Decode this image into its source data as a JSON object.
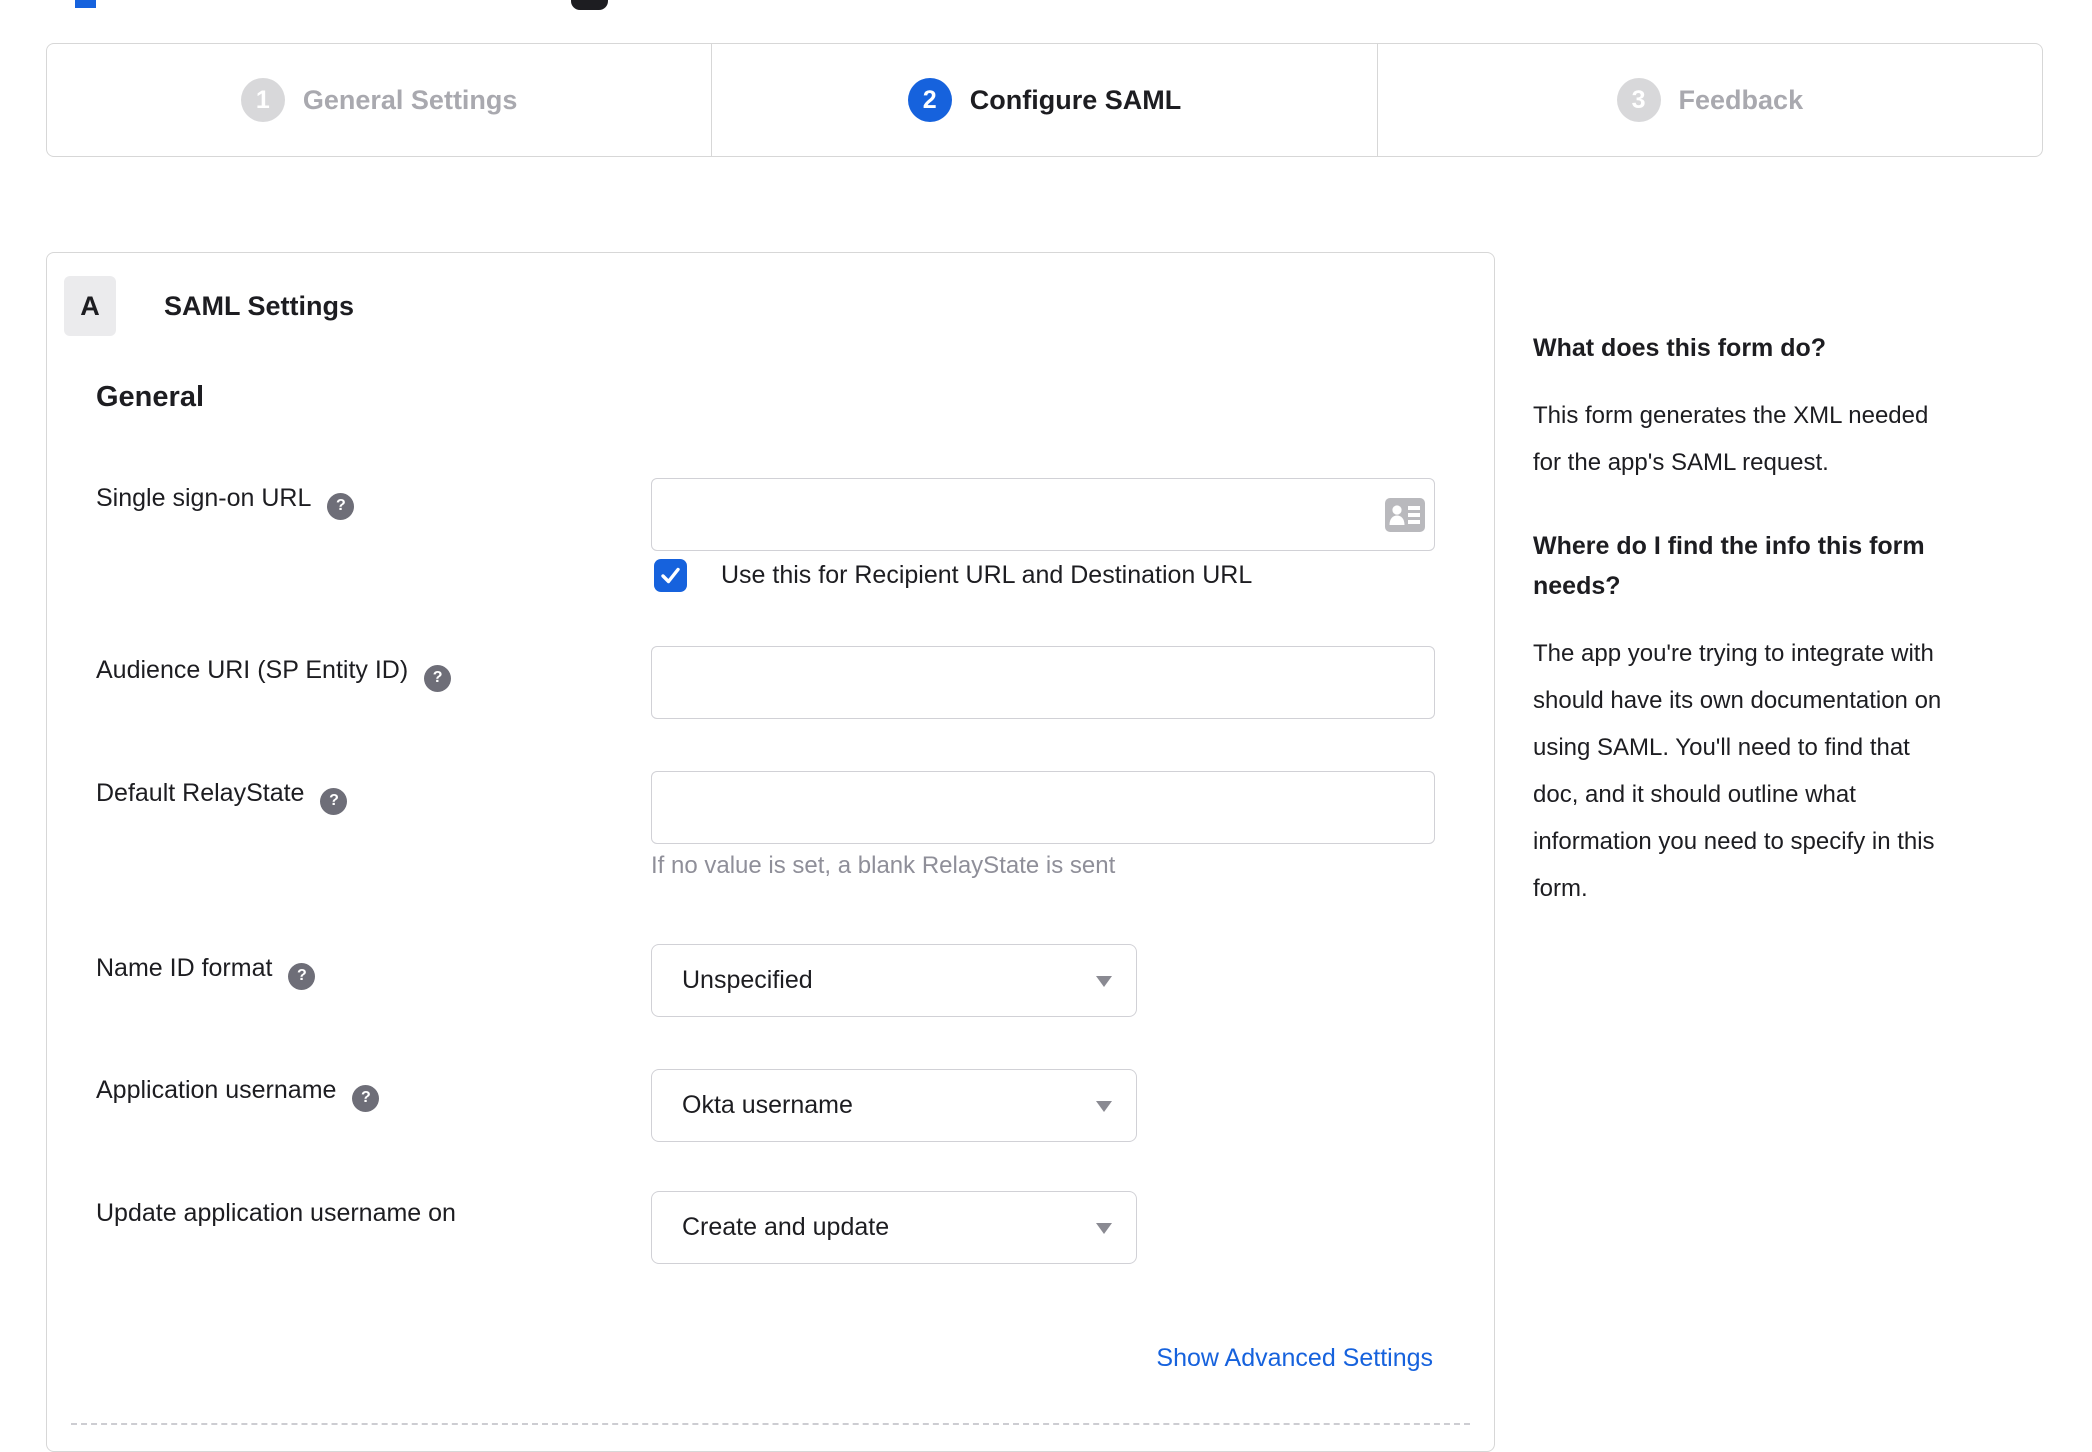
{
  "colors": {
    "accent_blue": "#1662dd",
    "text_dark": "#1d1d21",
    "muted_gray": "#8f8f99",
    "border_gray": "#d7d7d7",
    "inactive_step_gray": "#d8d8da"
  },
  "stepper": {
    "steps": [
      {
        "number": "1",
        "label": "General Settings",
        "state": "inactive"
      },
      {
        "number": "2",
        "label": "Configure SAML",
        "state": "active"
      },
      {
        "number": "3",
        "label": "Feedback",
        "state": "inactive"
      }
    ]
  },
  "panel": {
    "section_badge": "A",
    "section_title": "SAML Settings",
    "group_heading": "General",
    "help_icon_glyph": "?",
    "fields": {
      "sso_url": {
        "label": "Single sign-on URL",
        "value": "",
        "checkbox_label": "Use this for Recipient URL and Destination URL",
        "checkbox_checked": true
      },
      "audience_uri": {
        "label": "Audience URI (SP Entity ID)",
        "value": ""
      },
      "default_relaystate": {
        "label": "Default RelayState",
        "value": "",
        "hint": "If no value is set, a blank RelayState is sent"
      },
      "name_id_format": {
        "label": "Name ID format",
        "value": "Unspecified"
      },
      "application_username": {
        "label": "Application username",
        "value": "Okta username"
      },
      "update_app_username_on": {
        "label": "Update application username on",
        "value": "Create and update"
      }
    },
    "advanced_link": "Show Advanced Settings"
  },
  "sidebar": {
    "heading1": "What does this form do?",
    "paragraph1": "This form generates the XML needed\nfor the app's SAML request.",
    "heading2": "Where do I find the info this form\nneeds?",
    "paragraph2": "The app you're trying to integrate with\nshould have its own documentation on\nusing SAML. You'll need to find that\ndoc, and it should outline what\ninformation you need to specify in this\nform."
  }
}
